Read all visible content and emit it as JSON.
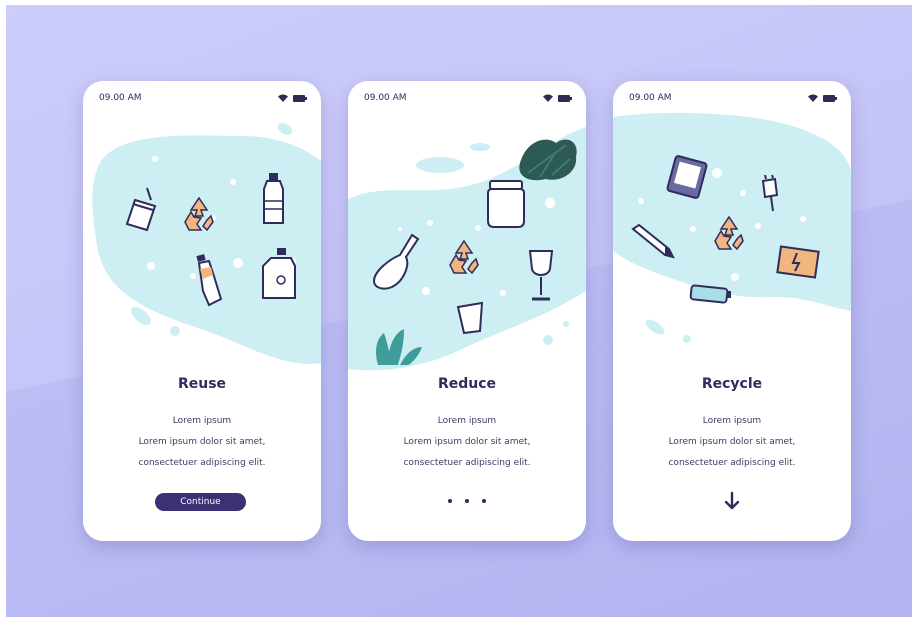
{
  "screens": [
    {
      "time": "09.00 AM",
      "title": "Reuse",
      "line1": "Lorem ipsum",
      "line2": "Lorem ipsum dolor sit amet,",
      "line3": "consectetuer adipiscing elit.",
      "button_label": "Continue"
    },
    {
      "time": "09.00 AM",
      "title": "Reduce",
      "line1": "Lorem ipsum",
      "line2": "Lorem ipsum dolor sit amet,",
      "line3": "consectetuer adipiscing elit."
    },
    {
      "time": "09.00 AM",
      "title": "Recycle",
      "line1": "Lorem ipsum",
      "line2": "Lorem ipsum dolor sit amet,",
      "line3": "consectetuer adipiscing elit."
    }
  ],
  "colors": {
    "background": "#c6c6f8",
    "blob": "#cdeef3",
    "accent": "#3a3274",
    "text": "#2f2c5c",
    "recycle": "#f1b67e",
    "leaf": "#2d5a55"
  },
  "icons": [
    "wifi-icon",
    "battery-icon",
    "recycle-icon",
    "arrow-down-icon"
  ]
}
